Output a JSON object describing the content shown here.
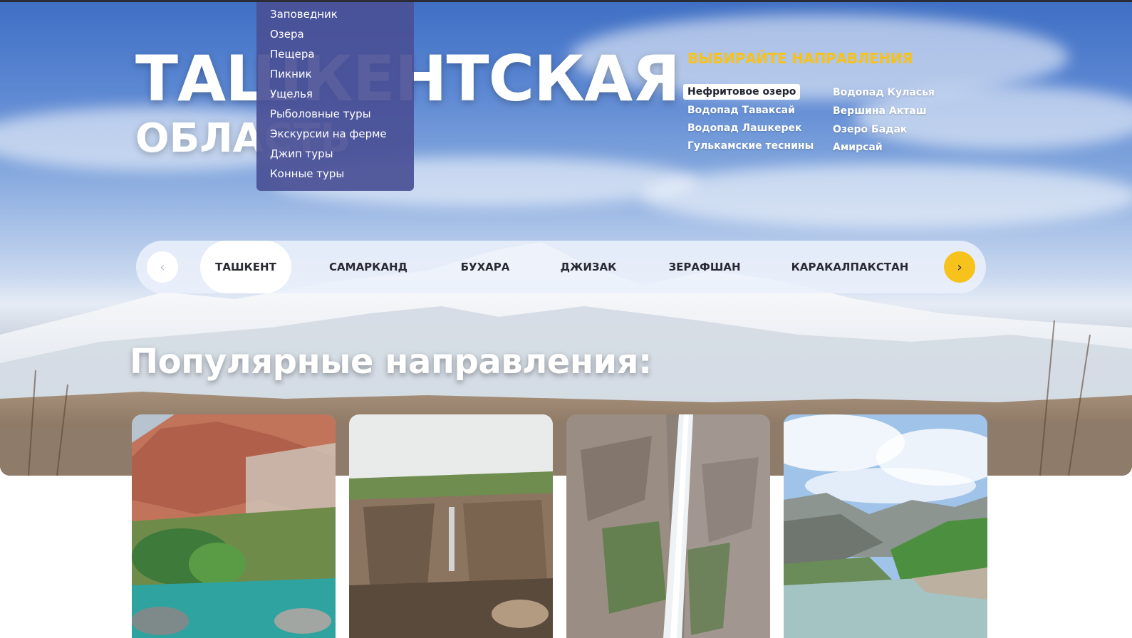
{
  "hero": {
    "title_line1": "ТАШКЕНТСКАЯ",
    "title_line2": "ОБЛАСТЬ"
  },
  "dropdown": {
    "items": [
      "Заповедник",
      "Озера",
      "Пещера",
      "Пикник",
      "Ущелья",
      "Рыболовные туры",
      "Экскурсии на ферме",
      "Джип туры",
      "Конные туры"
    ]
  },
  "destinations": {
    "heading": "ВЫБИРАЙТЕ НАПРАВЛЕНИЯ",
    "column1": [
      "Нефритовое озеро",
      "Водопад Таваксай",
      "Водопад Лашкерек",
      "Гулькамские теснины"
    ],
    "column2": [
      "Водопад Куласья",
      "Вершина Акташ",
      "Озеро Бадак",
      "Амирсай"
    ],
    "active": "Нефритовое озеро"
  },
  "regions": {
    "prev_icon": "chevron-left-icon",
    "next_icon": "chevron-right-icon",
    "tabs": [
      "ТАШКЕНТ",
      "САМАРКАНД",
      "БУХАРА",
      "ДЖИЗАК",
      "ЗЕРАФШАН",
      "КАРАКАЛПАКСТАН"
    ],
    "active": "ТАШКЕНТ"
  },
  "popular": {
    "title": "Популярные направления:"
  },
  "colors": {
    "accent_yellow": "#f6c21b",
    "dropdown_bg": "#4a5096",
    "text_dark": "#2a2a35"
  }
}
